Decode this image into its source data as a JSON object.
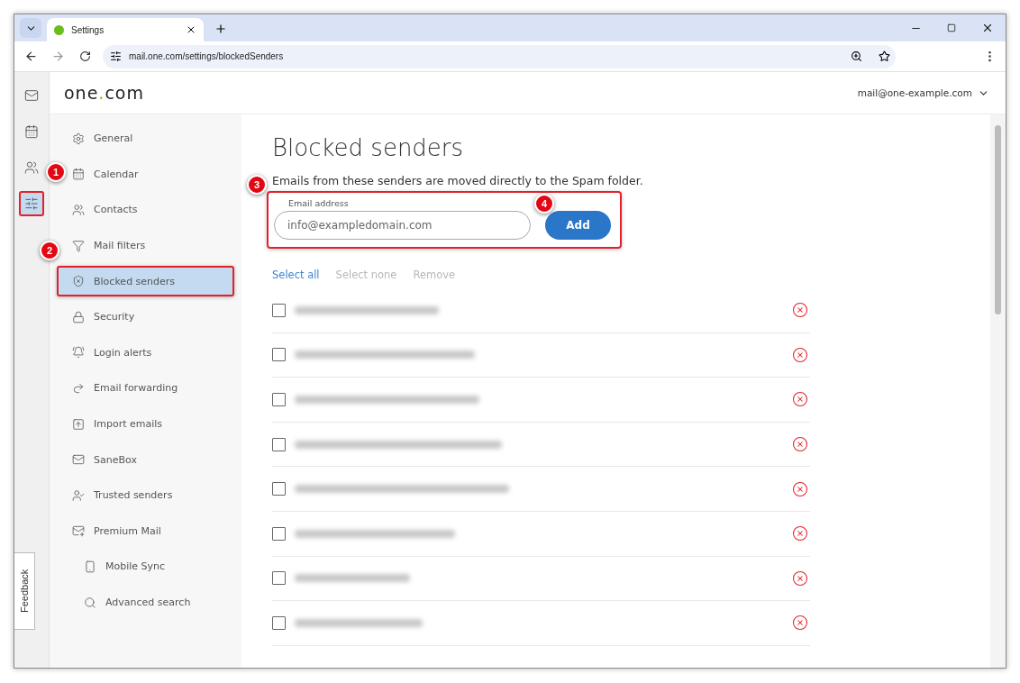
{
  "browser": {
    "tab_title": "Settings",
    "url": "mail.one.com/settings/blockedSenders"
  },
  "rail": [
    {
      "selected": false,
      "highlighted": false
    },
    {
      "selected": false,
      "highlighted": false
    },
    {
      "selected": false,
      "highlighted": false
    },
    {
      "selected": true,
      "highlighted": true
    }
  ],
  "feedback": "Feedback",
  "header": {
    "logo_left": "one",
    "logo_dot": ".",
    "logo_right": "com",
    "account": "mail@one-example.com"
  },
  "nav": [
    {
      "label": "General",
      "selected": false,
      "highlighted": false
    },
    {
      "label": "Calendar",
      "selected": false,
      "highlighted": false
    },
    {
      "label": "Contacts",
      "selected": false,
      "highlighted": false
    },
    {
      "label": "Mail filters",
      "selected": false,
      "highlighted": false
    },
    {
      "label": "Blocked senders",
      "selected": true,
      "highlighted": true
    },
    {
      "label": "Security",
      "selected": false,
      "highlighted": false
    },
    {
      "label": "Login alerts",
      "selected": false,
      "highlighted": false
    },
    {
      "label": "Email forwarding",
      "selected": false,
      "highlighted": false
    },
    {
      "label": "Import emails",
      "selected": false,
      "highlighted": false
    },
    {
      "label": "SaneBox",
      "selected": false,
      "highlighted": false
    },
    {
      "label": "Trusted senders",
      "selected": false,
      "highlighted": false
    },
    {
      "label": "Premium Mail",
      "selected": false,
      "highlighted": false,
      "children": [
        {
          "label": "Mobile Sync",
          "selected": false,
          "highlighted": false
        },
        {
          "label": "Advanced search",
          "selected": false,
          "highlighted": false
        }
      ]
    }
  ],
  "content": {
    "title": "Blocked senders",
    "description": "Emails from these senders are moved directly to the Spam folder.",
    "form": {
      "highlighted": true,
      "label": "Email address",
      "value": "info@exampledomain.com",
      "button": "Add"
    },
    "actions": [
      {
        "label": "Select all",
        "disabled": false
      },
      {
        "label": "Select none",
        "disabled": true
      },
      {
        "label": "Remove",
        "disabled": true
      }
    ],
    "rows": [
      {
        "checked": false
      },
      {
        "checked": false
      },
      {
        "checked": false
      },
      {
        "checked": false
      },
      {
        "checked": false
      },
      {
        "checked": false
      },
      {
        "checked": false
      },
      {
        "checked": false
      }
    ]
  },
  "annotations": [
    {
      "number": "1"
    },
    {
      "number": "2"
    },
    {
      "number": "3"
    },
    {
      "number": "4"
    }
  ]
}
